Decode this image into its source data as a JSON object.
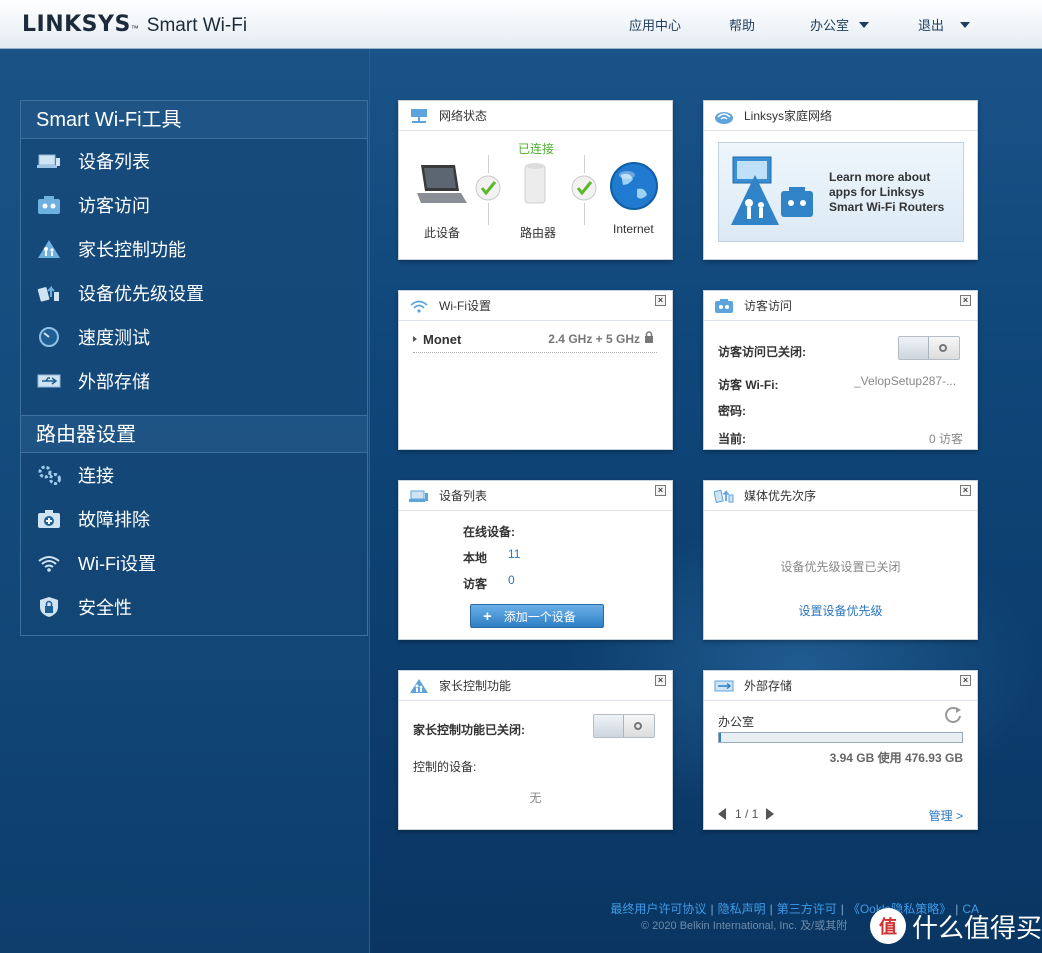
{
  "header": {
    "brand": "LINKSYS",
    "tm": "™",
    "product": "Smart Wi-Fi",
    "nav": {
      "apps": "应用中心",
      "help": "帮助",
      "location": "办公室",
      "logout": "退出"
    }
  },
  "sidebar": {
    "tools_title": "Smart Wi-Fi工具",
    "tools": [
      {
        "label": "设备列表",
        "icon": "device-list-icon"
      },
      {
        "label": "访客访问",
        "icon": "guest-access-icon"
      },
      {
        "label": "家长控制功能",
        "icon": "parental-control-icon"
      },
      {
        "label": "设备优先级设置",
        "icon": "device-priority-icon"
      },
      {
        "label": "速度测试",
        "icon": "speed-test-icon"
      },
      {
        "label": "外部存储",
        "icon": "usb-storage-icon"
      }
    ],
    "router_title": "路由器设置",
    "router": [
      {
        "label": "连接",
        "icon": "connectivity-gear-icon"
      },
      {
        "label": "故障排除",
        "icon": "troubleshooting-icon"
      },
      {
        "label": "Wi-Fi设置",
        "icon": "wifi-icon"
      },
      {
        "label": "安全性",
        "icon": "security-shield-icon"
      }
    ]
  },
  "network_status": {
    "title": "网络状态",
    "connected": "已连接",
    "this_device": "此设备",
    "router": "路由器",
    "internet": "Internet"
  },
  "home_network": {
    "title": "Linksys家庭网络",
    "promo_line1": "Learn more about",
    "promo_line2": "apps for Linksys",
    "promo_line3": "Smart Wi-Fi Routers"
  },
  "wifi_settings": {
    "title": "Wi-Fi设置",
    "network_name": "Monet",
    "bands": "2.4 GHz + 5 GHz"
  },
  "guest_access": {
    "title": "访客访问",
    "status_label": "访客访问已关闭:",
    "wifi_label": "访客 Wi-Fi:",
    "wifi_value": "_VelopSetup287-...",
    "password_label": "密码:",
    "current_label": "当前:",
    "current_value": "0 访客"
  },
  "device_list": {
    "title": "设备列表",
    "online_label": "在线设备:",
    "local_label": "本地",
    "local_count": "11",
    "guest_label": "访客",
    "guest_count": "0",
    "add_button": "添加一个设备"
  },
  "media_priority": {
    "title": "媒体优先次序",
    "status": "设备优先级设置已关闭",
    "link": "设置设备优先级"
  },
  "parental_controls": {
    "title": "家长控制功能",
    "status_label": "家长控制功能已关闭:",
    "devices_label": "控制的设备:",
    "devices_value": "无"
  },
  "external_storage": {
    "title": "外部存储",
    "drive_name": "办公室",
    "usage_text": "3.94 GB 使用 476.93 GB",
    "usage_fraction": 0.008,
    "pager": "1 / 1",
    "manage_link": "管理 >"
  },
  "footer": {
    "eula": "最终用户许可协议",
    "privacy": "隐私声明",
    "third_party": "第三方许可",
    "ookla": "《Ookla隐私策略》",
    "region": "CA",
    "copyright": "© 2020 Belkin International, Inc. 及/或其附"
  },
  "watermark": {
    "badge": "值",
    "text": "什么值得买"
  },
  "colors": {
    "header_bg": "#ffffff",
    "page_bg": "#0d3f6f",
    "link_blue": "#2a77c0",
    "connected_green": "#4cb030"
  }
}
